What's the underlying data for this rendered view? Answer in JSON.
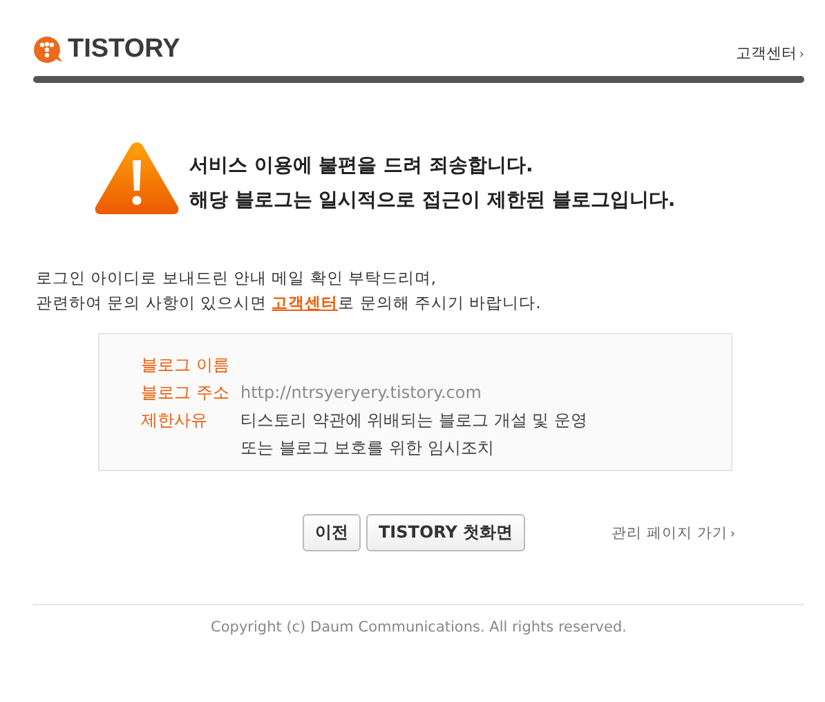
{
  "header": {
    "logo": "TISTORY",
    "help_link": "고객센터",
    "help_arrow": "›"
  },
  "notice": {
    "title_lines": [
      "서비스 이용에 불편을 드려 죄송합니다.",
      "해당 블로그는 일시적으로 접근이 제한된 블로그입니다."
    ]
  },
  "message": {
    "line_1": "로그인 아이디로 보내드린 안내 메일 확인 부탁드리며,",
    "line_2_before": "관련하여 문의 사항이 있으시면 ",
    "line_2_link": "고객센터",
    "line_2_after": "로 문의해 주시기 바랍니다."
  },
  "info": [
    {
      "label": "블로그 이름"
    },
    {
      "label": "블로그 주소",
      "value_lines": [
        "http://ntrsyeryery.tistory.com"
      ],
      "faded": true
    },
    {
      "label": "제한사유",
      "value_lines": [
        "티스토리 약관에 위배되는 블로그 개설 및 운영",
        "또는 블로그 보호를 위한 임시조치"
      ],
      "faded": false
    }
  ],
  "buttons": [
    "이전",
    "TISTORY 첫화면"
  ],
  "admin_link": "관리 페이지 가기",
  "admin_arrow": "›",
  "footer": "Copyright (c) Daum Communications. All rights reserved."
}
